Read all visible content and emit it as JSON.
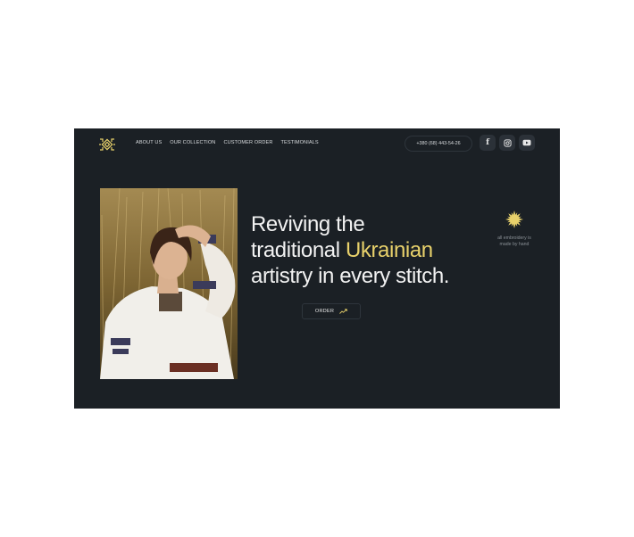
{
  "nav": {
    "items": [
      "ABOUT US",
      "OUR COLLECTION",
      "CUSTOMER ORDER",
      "TESTIMONIALS"
    ]
  },
  "contact": {
    "phone": "+380 (68) 443-54-26"
  },
  "social": {
    "icons": [
      "facebook-icon",
      "instagram-icon",
      "youtube-icon"
    ],
    "facebook_glyph": "f"
  },
  "hero": {
    "headline_line1": "Reviving the",
    "headline_line2_prefix": "traditional ",
    "headline_accent": "Ukrainian",
    "headline_line3": "artistry in every stitch.",
    "order_label": "ORDER",
    "note_line1": "all embroidery is",
    "note_line2": "made by hand"
  },
  "colors": {
    "page_bg": "#ffffff",
    "panel_bg": "#1b2025",
    "accent_yellow": "#e8d16b",
    "text_light": "#f2f2f2",
    "muted_text": "#8a9096"
  }
}
